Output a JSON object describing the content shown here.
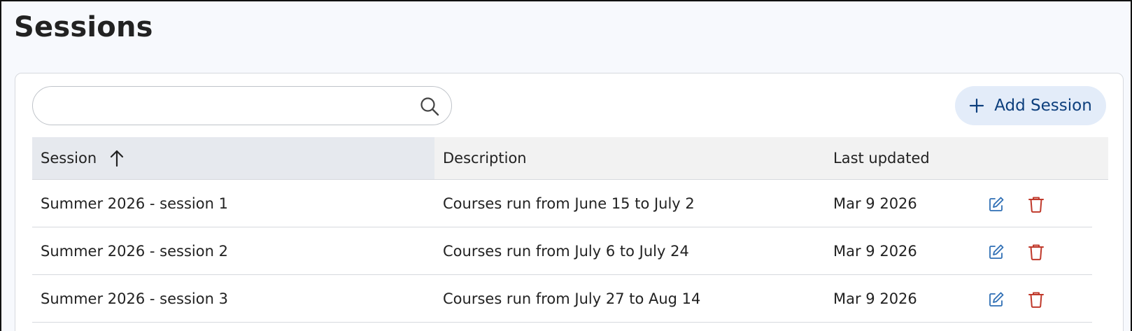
{
  "page": {
    "title": "Sessions"
  },
  "search": {
    "value": "",
    "placeholder": ""
  },
  "toolbar": {
    "add_label": "Add Session"
  },
  "table": {
    "columns": [
      "Session",
      "Description",
      "Last updated"
    ],
    "sort": {
      "column": "Session",
      "direction": "ascending"
    },
    "rows": [
      {
        "session": "Summer 2026 - session 1",
        "description": "Courses run from June 15 to July 2",
        "updated": "Mar 9 2026"
      },
      {
        "session": "Summer 2026 - session 2",
        "description": "Courses run from July 6 to July 24",
        "updated": "Mar 9 2026"
      },
      {
        "session": "Summer 2026 - session 3",
        "description": "Courses run from July 27 to Aug 14",
        "updated": "Mar 9 2026"
      }
    ]
  },
  "icons": {
    "search": "search-icon",
    "add": "plus-icon",
    "sort": "arrow-up-icon",
    "edit": "edit-icon",
    "delete": "trash-icon"
  },
  "colors": {
    "accent": "#0d3f7d",
    "edit": "#2f6fb5",
    "delete": "#c0392b",
    "button_bg": "#e3ecf9"
  }
}
